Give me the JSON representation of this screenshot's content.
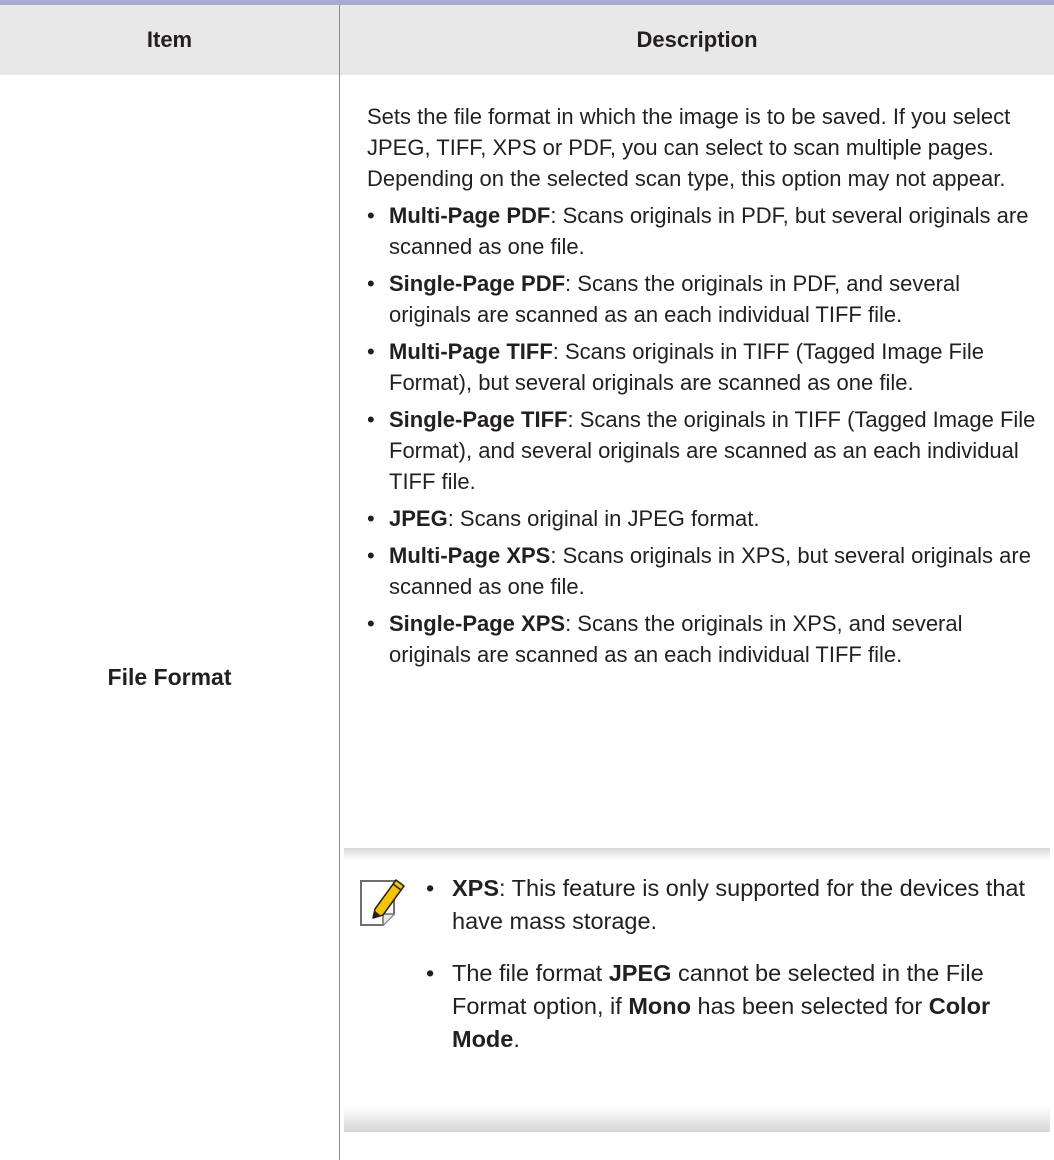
{
  "table": {
    "headers": {
      "item": "Item",
      "description": "Description"
    },
    "row": {
      "label": "File Format",
      "intro": "Sets the file format in which the image is to be saved. If you select JPEG, TIFF, XPS or PDF, you can select to scan multiple pages. Depending on the selected scan type, this option may not appear.",
      "bullet_glyph": "•",
      "items": [
        {
          "term": "Multi-Page PDF",
          "text": ": Scans originals in PDF, but several originals are scanned as one file."
        },
        {
          "term": "Single-Page PDF",
          "text": ": Scans the originals in PDF, and several originals are scanned as an each individual TIFF file."
        },
        {
          "term": "Multi-Page TIFF",
          "text": ": Scans originals in TIFF (Tagged Image File Format), but several originals are scanned as one file."
        },
        {
          "term": "Single-Page TIFF",
          "text": ": Scans the originals in TIFF (Tagged Image File Format), and several originals are scanned as an each individual TIFF file."
        },
        {
          "term": "JPEG",
          "text": ": Scans original in JPEG format."
        },
        {
          "term": "Multi-Page XPS",
          "text": ": Scans originals in XPS, but several originals are scanned as one file."
        },
        {
          "term": "Single-Page XPS",
          "text": ": Scans the originals in XPS, and several originals are scanned as an each individual TIFF file."
        }
      ],
      "note": {
        "icon": "note-pencil-icon",
        "item1": {
          "term": "XPS",
          "text": ": This feature is only supported for the devices that have mass storage."
        },
        "item2": {
          "t1": "The file format ",
          "b1": "JPEG",
          "t2": " cannot be selected in the File Format option, if ",
          "b2": "Mono",
          "t3": " has been selected for ",
          "b3": "Color Mode",
          "t4": "."
        }
      }
    }
  },
  "colors": {
    "header_bg": "#e8e8e8",
    "top_rule": "#a7a9d2",
    "text": "#231f20",
    "icon_accent": "#f5c400"
  }
}
